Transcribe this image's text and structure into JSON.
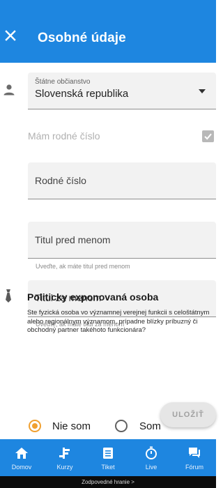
{
  "appbar": {
    "title": "Osobné údaje",
    "close_icon": "close-icon"
  },
  "form": {
    "citizenship": {
      "label": "Štátne občianstvo",
      "value": "Slovenská republika"
    },
    "has_birth_number": {
      "label": "Mám rodné číslo",
      "checked": true
    },
    "birth_number": {
      "placeholder": "Rodné číslo"
    },
    "title_before": {
      "placeholder": "Titul pred menom",
      "helper": "Uveďte, ak máte titul pred menom"
    },
    "title_after": {
      "placeholder": "Titul za menom",
      "helper": "Uveďte, ak máte titul za menom"
    },
    "pep": {
      "title": "Politicky exponovaná osoba",
      "description": "Ste fyzická osoba vo významnej verejnej funkcii s celoštátnym alebo regionálnym významom, prípadne blízky príbuzný či obchodný partner takéhoto funkcionára?",
      "options": [
        "Nie som",
        "Som"
      ],
      "selected": "Nie som"
    },
    "save_label": "ULOŽIŤ"
  },
  "bottom_nav": {
    "items": [
      {
        "label": "Domov",
        "icon": "home-icon"
      },
      {
        "label": "Kurzy",
        "icon": "odds-icon"
      },
      {
        "label": "Tiket",
        "icon": "ticket-icon"
      },
      {
        "label": "Live",
        "icon": "stopwatch-icon"
      },
      {
        "label": "Fórum",
        "icon": "forum-icon"
      }
    ]
  },
  "footer": {
    "text": "Zodpovedné hranie >"
  },
  "colors": {
    "primary": "#1e86e0",
    "accent": "#f0a030",
    "field_bg": "#f2f2f2"
  }
}
